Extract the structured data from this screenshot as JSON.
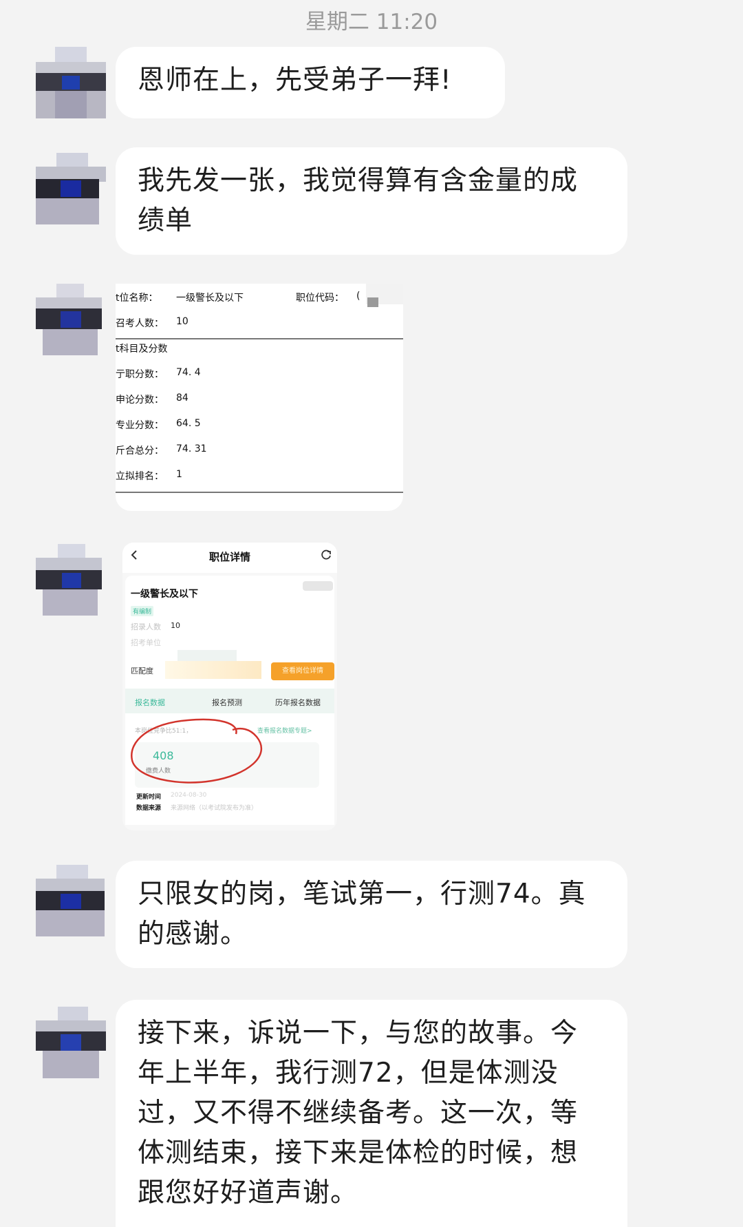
{
  "header": {
    "timestamp": "星期二 11:20"
  },
  "messages": [
    {
      "text": "恩师在上，先受弟子一拜!"
    },
    {
      "text": "我先发一张，我觉得算有含金量的成\n绩单"
    },
    {},
    {},
    {
      "text": "只限女的岗，笔试第一，行测74。真\n的感谢。"
    },
    {
      "text": "接下来，诉说一下，与您的故事。今\n年上半年，我行测72，但是体测没\n过，又不得不继续备考。这一次，等\n体测结束，接下来是体检的时候，想\n跟您好好道声谢。"
    }
  ],
  "score_sheet": {
    "position_name_label": "t位名称：",
    "position_name": "一级警长及以下",
    "position_code_label": "职位代码：",
    "position_code_partial": "(",
    "recruit_count_label": "召考人数：",
    "recruit_count": "10",
    "subjects_label": "t科目及分数",
    "rows": [
      {
        "label": "亍职分数：",
        "value": "74. 4"
      },
      {
        "label": "申论分数：",
        "value": "84"
      },
      {
        "label": "专业分数：",
        "value": "64. 5"
      },
      {
        "label": "斤合总分：",
        "value": "74. 31"
      },
      {
        "label": "立拟排名：",
        "value": "1"
      }
    ]
  },
  "app_screenshot": {
    "back_icon": "chevron-left-icon",
    "refresh_icon": "refresh-icon",
    "page_title": "职位详情",
    "position_title": "一级警长及以下",
    "tag": "有编制",
    "recruit_label": "招录人数",
    "recruit_value": "10",
    "unit_label": "招考单位",
    "match_label": "匹配度",
    "orange_button": "查看岗位详情",
    "tabs": [
      "报名数据",
      "报名预测",
      "历年报名数据"
    ],
    "ratio_text": "本岗位竞争比51:1，",
    "link_text": "查看报名数据专题>",
    "count_value": "408",
    "count_label": "缴费人数",
    "update_time_label": "更新时间",
    "update_time_value": "2024-08-30",
    "source_label": "数据来源",
    "source_value": "来源网络（以考试院发布为准）",
    "colors": {
      "accent_green": "#3cb99a",
      "orange": "#f5a12a",
      "circle_red": "#d2342c"
    }
  }
}
